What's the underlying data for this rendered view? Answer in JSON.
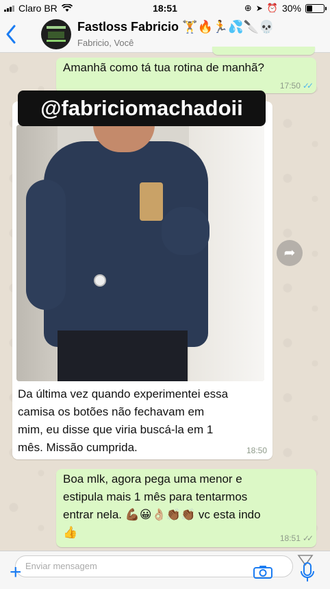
{
  "status_bar": {
    "carrier": "Claro BR",
    "time": "18:51",
    "battery": "30%"
  },
  "header": {
    "back_icon": "chevron-left-icon",
    "title": "Fastloss Fabricio 🏋🔥🏃💦🔪💀",
    "subtitle": "Fabricio, Você"
  },
  "messages": [
    {
      "text": "Amanhã como tá tua rotina de manhã?",
      "time": "17:50",
      "status": "read"
    },
    {
      "handle": "@fabriciomachadoii",
      "text": "Da última vez  quando experimentei essa camisa os botões  não fechavam em mim, eu disse que viria buscá-la em 1 mês. Missão cumprida.",
      "text_lines": [
        "Da última vez  quando experimentei essa",
        "camisa os botões  não fechavam em",
        "mim, eu disse que viria buscá-la em 1",
        "mês. Missão cumprida."
      ],
      "time": "18:50"
    },
    {
      "text_lines": [
        "Boa mlk, agora pega uma menor e",
        "estipula mais 1 mês para tentarmos",
        "entrar nela. 💪🏾😀👌🏼👏🏾👏🏾 vc esta indo",
        "👍"
      ],
      "time": "18:51",
      "status": "delivered"
    }
  ],
  "input": {
    "placeholder": "Enviar mensagem"
  },
  "colors": {
    "outgoing_bubble": "#dcf8c6",
    "incoming_bubble": "#ffffff",
    "accent": "#1b7cf2",
    "read_ticks": "#4fb6ec"
  }
}
